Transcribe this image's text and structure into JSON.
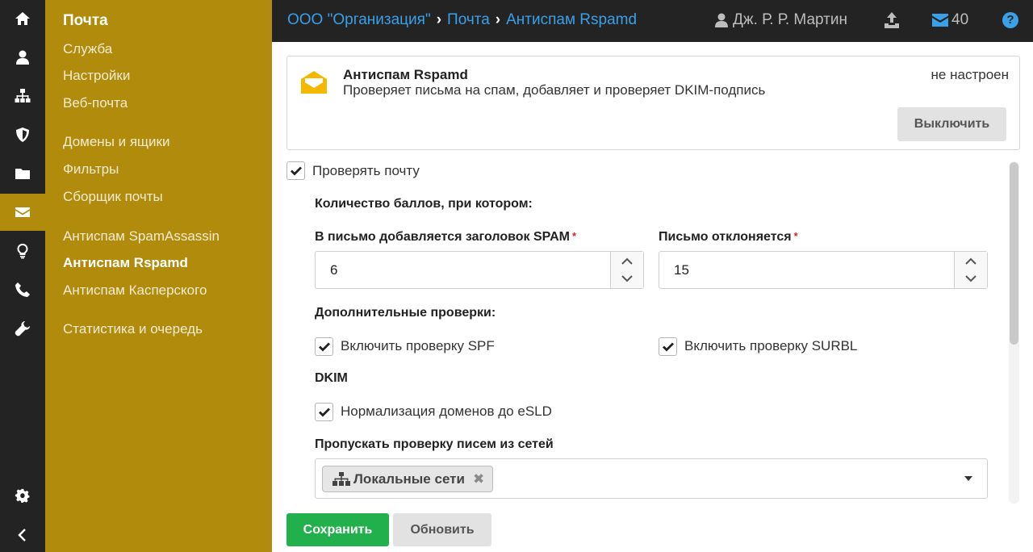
{
  "rail": {
    "icons": [
      "home-icon",
      "user-icon",
      "sitemap-icon",
      "shield-icon",
      "folder-icon",
      "envelope-icon",
      "lightbulb-icon",
      "phone-icon",
      "wrench-icon",
      "gear-icon",
      "chevron-left-icon"
    ],
    "active": "envelope-icon",
    "active_color": "#b08b0c",
    "bg_color": "#232323"
  },
  "submenu": {
    "title": "Почта",
    "items": [
      "Служба",
      "Настройки",
      "Веб-почта",
      "Домены и ящики",
      "Фильтры",
      "Сборщик почты",
      "Антиспам SpamAssassin",
      "Антиспам Rspamd",
      "Антиспам Касперского",
      "Статистика и очередь"
    ],
    "current": "Антиспам Rspamd"
  },
  "header": {
    "breadcrumbs": [
      "ООО \"Организация\"",
      "Почта",
      "Антиспам Rspamd"
    ],
    "user_name": "Дж. Р. Р. Мартин",
    "mail_count": "40",
    "help_label": "?",
    "link_color": "#3aa0e8"
  },
  "module": {
    "name": "Антиспам Rspamd",
    "description": "Проверяет письма на спам, добавляет и проверяет DKIM-подпись",
    "status": "не настроен",
    "toggle_button": "Выключить"
  },
  "form": {
    "check_mail": {
      "label": "Проверять почту",
      "checked": true
    },
    "score_heading": "Количество баллов, при котором:",
    "spam_header": {
      "label": "В письмо добавляется заголовок SPAM",
      "required_mark": "*",
      "value": "6"
    },
    "reject": {
      "label": "Письмо отклоняется",
      "required_mark": "*",
      "value": "15"
    },
    "extra_heading": "Дополнительные проверки:",
    "spf": {
      "label": "Включить проверку SPF",
      "checked": true
    },
    "surbl": {
      "label": "Включить проверку SURBL",
      "checked": true
    },
    "dkim_heading": "DKIM",
    "esld": {
      "label": "Нормализация доменов до eSLD",
      "checked": true
    },
    "skip_networks": {
      "label": "Пропускать проверку писем из сетей",
      "tags": [
        "Локальные сети"
      ],
      "remove_glyph": "✖"
    }
  },
  "actions": {
    "save": "Сохранить",
    "refresh": "Обновить",
    "save_color": "#21b04b"
  }
}
